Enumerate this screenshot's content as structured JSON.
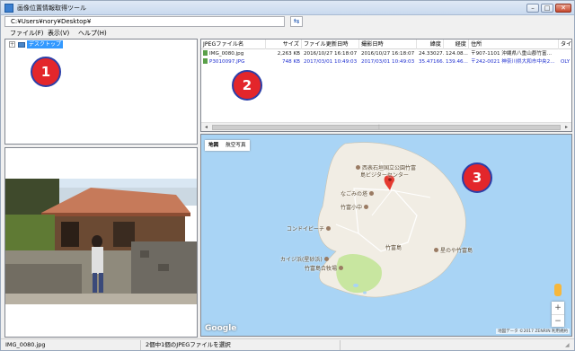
{
  "window": {
    "title": "画像位置情報取得ツール",
    "controls": {
      "minimize": "–",
      "maximize": "□",
      "close": "✕"
    }
  },
  "path": {
    "value": "C:¥Users¥nory¥Desktop¥",
    "sync_icon": "link-arrow-icon",
    "sync_glyph": "⇆"
  },
  "menu": {
    "items": [
      "ファイル(F)",
      "表示(V)",
      "ヘルプ(H)"
    ]
  },
  "tree": {
    "expander": "+",
    "root_label": "デスクトップ"
  },
  "file_list": {
    "columns": [
      "JPEGファイル名",
      "サイズ",
      "ファイル更新日時",
      "撮影日時",
      "緯度",
      "経度",
      "住所",
      "タイト"
    ],
    "rows": [
      {
        "name": "IMG_0080.jpg",
        "size": "2,263 KB",
        "modified": "2016/10/27 16:18:07",
        "taken": "2016/10/27 16:18:07",
        "lat": "24.33027...",
        "lng": "124.08...",
        "address": "〒907-1101 沖縄県八重山郡竹富...",
        "title": ""
      },
      {
        "name": "P3010097.JPG",
        "size": "748 KB",
        "modified": "2017/03/01 10:49:03",
        "taken": "2017/03/01 10:49:03",
        "lat": "35.47166...",
        "lng": "139.46...",
        "address": "〒242-0021 神奈川県大和市中央2...",
        "title": "OLY"
      }
    ],
    "scroll": {
      "left": "◂",
      "right": "▸",
      "grip": "⋮"
    }
  },
  "map": {
    "type_buttons": [
      "地図",
      "航空写真"
    ],
    "labels": {
      "poi1": "西表石垣国立公園竹富",
      "poi1b": "島ビジターセンター",
      "poi2": "なごみの塔",
      "poi3": "竹富小中",
      "poi4": "コンドイビーチ",
      "poi5": "竹富島",
      "poi6": "星のや竹富島",
      "poi7": "カイジ浜(星砂浜)",
      "poi8": "竹富島合",
      "poi8b": "牧場"
    },
    "google": "Google",
    "footer": "地図データ ©2017 ZENRIN  利用規約",
    "zoom_in": "+",
    "zoom_out": "−",
    "colors": {
      "water": "#a9d4f5",
      "land": "#f1ede4",
      "park": "#c8e6a0",
      "marker": "#e53a30"
    }
  },
  "badges": [
    "1",
    "2",
    "3"
  ],
  "status": {
    "filename": "IMG_0080.jpg",
    "message": "2個中1個のJPEGファイルを選択",
    "grip": "◢"
  }
}
